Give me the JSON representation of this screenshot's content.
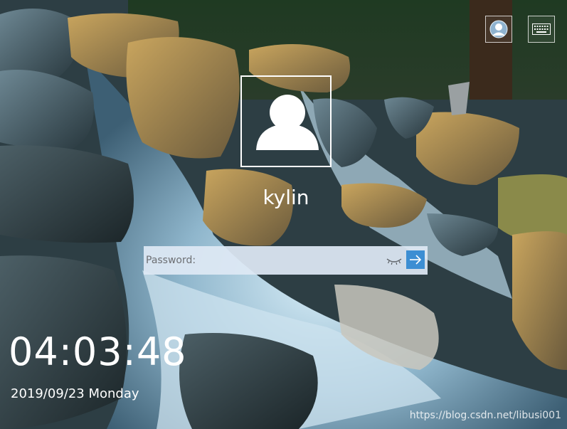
{
  "wallpaper": {
    "description_icon": "waterfall-landscape"
  },
  "top_bar": {
    "user_switch_icon": "user-avatar-icon",
    "keyboard_icon": "keyboard-icon"
  },
  "login": {
    "avatar_icon": "user-silhouette-icon",
    "username": "kylin",
    "password_placeholder": "Password:",
    "password_value": "",
    "show_password_icon": "eye-closed-icon",
    "submit_icon": "arrow-right-icon"
  },
  "clock": {
    "time": "04:03:48",
    "date": "2019/09/23 Monday"
  },
  "watermark": "https://blog.csdn.net/libusi001",
  "colors": {
    "accent": "#3c8ed3",
    "field_bg": "#dee8f4",
    "text": "#ffffff"
  }
}
